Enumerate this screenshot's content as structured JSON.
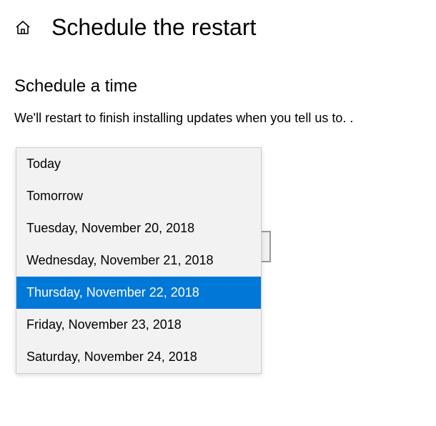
{
  "header": {
    "title": "Schedule the restart"
  },
  "section": {
    "heading": "Schedule a time",
    "description": "We'll restart to finish installing updates when you tell us to. ."
  },
  "dropdown": {
    "items": [
      {
        "label": "Today"
      },
      {
        "label": "Tomorrow"
      },
      {
        "label": "Tuesday, November 20, 2018"
      },
      {
        "label": "Wednesday, November 21, 2018"
      },
      {
        "label": "Thursday, November 22, 2018"
      },
      {
        "label": "Friday, November 23, 2018"
      },
      {
        "label": "Saturday, November 24, 2018"
      }
    ],
    "selectedIndex": 4
  }
}
